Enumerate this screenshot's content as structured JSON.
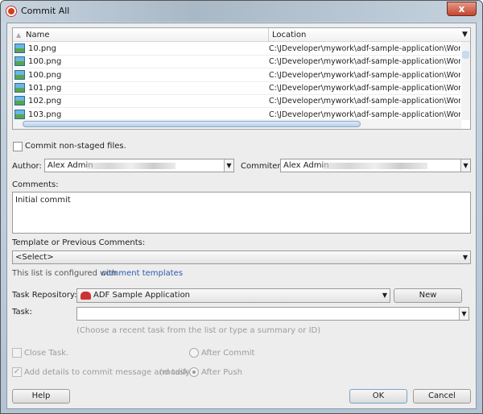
{
  "window": {
    "title": "Commit All",
    "close": "x"
  },
  "table": {
    "columns": [
      "Name",
      "Location"
    ],
    "rows": [
      {
        "name": "10.png",
        "location": "C:\\JDeveloper\\mywork\\adf-sample-application\\WorkBetter"
      },
      {
        "name": "100.png",
        "location": "C:\\JDeveloper\\mywork\\adf-sample-application\\WorkBetter"
      },
      {
        "name": "100.png",
        "location": "C:\\JDeveloper\\mywork\\adf-sample-application\\WorkBetter"
      },
      {
        "name": "101.png",
        "location": "C:\\JDeveloper\\mywork\\adf-sample-application\\WorkBetter"
      },
      {
        "name": "102.png",
        "location": "C:\\JDeveloper\\mywork\\adf-sample-application\\WorkBetter"
      },
      {
        "name": "103.png",
        "location": "C:\\JDeveloper\\mywork\\adf-sample-application\\WorkBetter"
      }
    ]
  },
  "form": {
    "commit_nonstaged": "Commit non-staged files.",
    "author_label": "Author:",
    "author_value": "Alex Admin",
    "commiter_label": "Commiter:",
    "commiter_value": "Alex Admin",
    "comments_label": "Comments:",
    "comments_value": "Initial commit",
    "template_label": "Template or Previous Comments:",
    "template_value": "<Select>",
    "template_hint": "This list is configured with",
    "template_link": "comment templates",
    "task_repo_label": "Task Repository:",
    "task_repo_value": "ADF Sample Application",
    "new_button": "New",
    "task_label": "Task:",
    "task_hint": "(Choose a recent task from the list or type a summary or ID)",
    "close_task": "Close Task.",
    "after_commit": "After Commit",
    "add_details": "Add details to commit message and task.",
    "modify": "(modify)",
    "after_push": "After Push"
  },
  "buttons": {
    "help": "Help",
    "ok": "OK",
    "cancel": "Cancel"
  }
}
